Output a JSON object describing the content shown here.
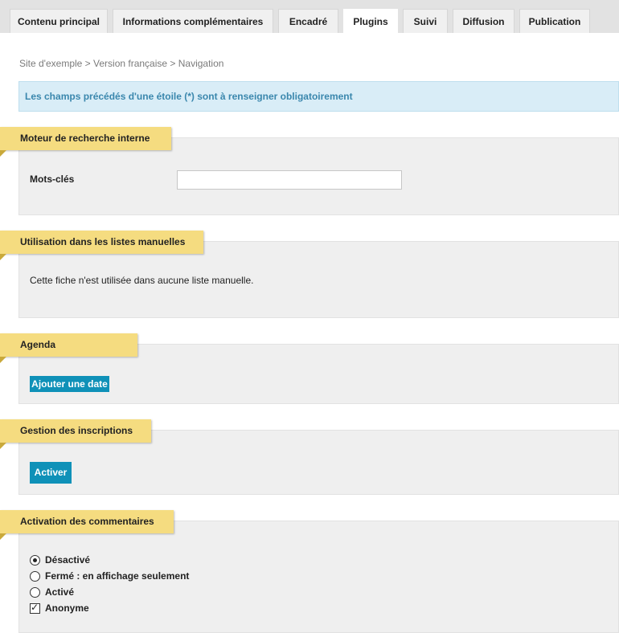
{
  "tabs": [
    {
      "label": "Contenu principal",
      "active": false
    },
    {
      "label": "Informations complémentaires",
      "active": false
    },
    {
      "label": "Encadré",
      "active": false
    },
    {
      "label": "Plugins",
      "active": true
    },
    {
      "label": "Suivi",
      "active": false
    },
    {
      "label": "Diffusion",
      "active": false
    },
    {
      "label": "Publication",
      "active": false
    }
  ],
  "breadcrumb": "Site d'exemple > Version française > Navigation",
  "alert": "Les champs précédés d'une étoile (*) sont à renseigner obligatoirement",
  "search_engine": {
    "legend": "Moteur de recherche interne",
    "keywords_label": "Mots-clés",
    "keywords_value": ""
  },
  "manual_lists": {
    "legend": "Utilisation dans les listes manuelles",
    "text": "Cette fiche n'est utilisée dans aucune liste manuelle."
  },
  "agenda": {
    "legend": "Agenda",
    "add_date_button": "Ajouter une date"
  },
  "registrations": {
    "legend": "Gestion des inscriptions",
    "activate_button": "Activer"
  },
  "comments": {
    "legend": "Activation des commentaires",
    "options": [
      {
        "label": "Désactivé",
        "type": "radio",
        "checked": true
      },
      {
        "label": "Fermé : en affichage seulement",
        "type": "radio",
        "checked": false
      },
      {
        "label": "Activé",
        "type": "radio",
        "checked": false
      },
      {
        "label": "Anonyme",
        "type": "checkbox",
        "checked": true
      }
    ]
  },
  "colors": {
    "legend_bg": "#f5dc80",
    "button_bg": "#0f91b8",
    "alert_bg": "#d9edf7",
    "alert_text": "#3a87ad",
    "panel_bg": "#efefef"
  }
}
